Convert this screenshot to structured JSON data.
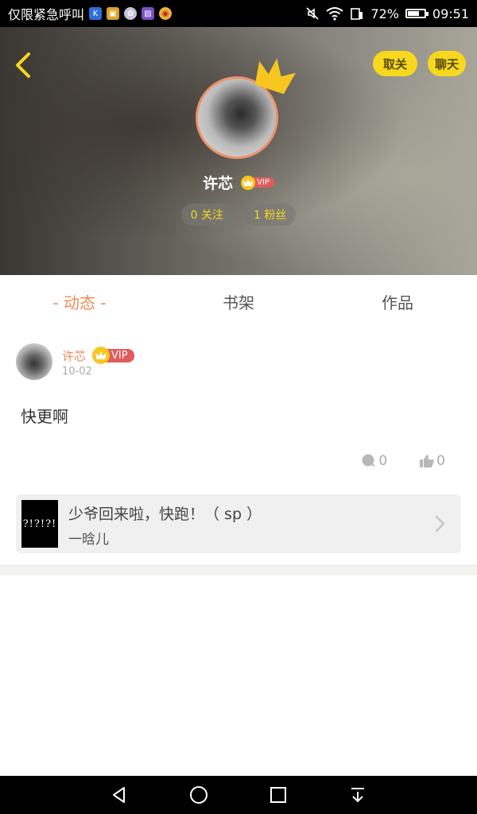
{
  "status_bar": {
    "emergency_text": "仅限紧急呼叫",
    "battery_text": "72%",
    "battery_level": 0.72,
    "time": "09:51",
    "app_icons": [
      "k-app-icon",
      "lock-app-icon",
      "gallery-app-icon",
      "photo-app-icon",
      "weibo-app-icon"
    ]
  },
  "header": {
    "unfollow_label": "取关",
    "chat_label": "聊天",
    "username": "许芯",
    "vip_label": "VIP",
    "following": "0 关注",
    "fans": "1 粉丝"
  },
  "tabs": [
    {
      "label": "- 动态 -",
      "active": true
    },
    {
      "label": "书架",
      "active": false
    },
    {
      "label": "作品",
      "active": false
    }
  ],
  "post": {
    "author": "许芯",
    "vip_label": "VIP",
    "date": "10-02",
    "content": "快更啊",
    "comment_count": "0",
    "like_count": "0",
    "book": {
      "cover_text": "?!?!?!",
      "title": "少爷回来啦，快跑！（ sp ）",
      "author": "一晗儿"
    }
  },
  "colors": {
    "accent": "#ef8a55",
    "yellow": "#f7d81f",
    "vip_red": "#e05b5b"
  }
}
